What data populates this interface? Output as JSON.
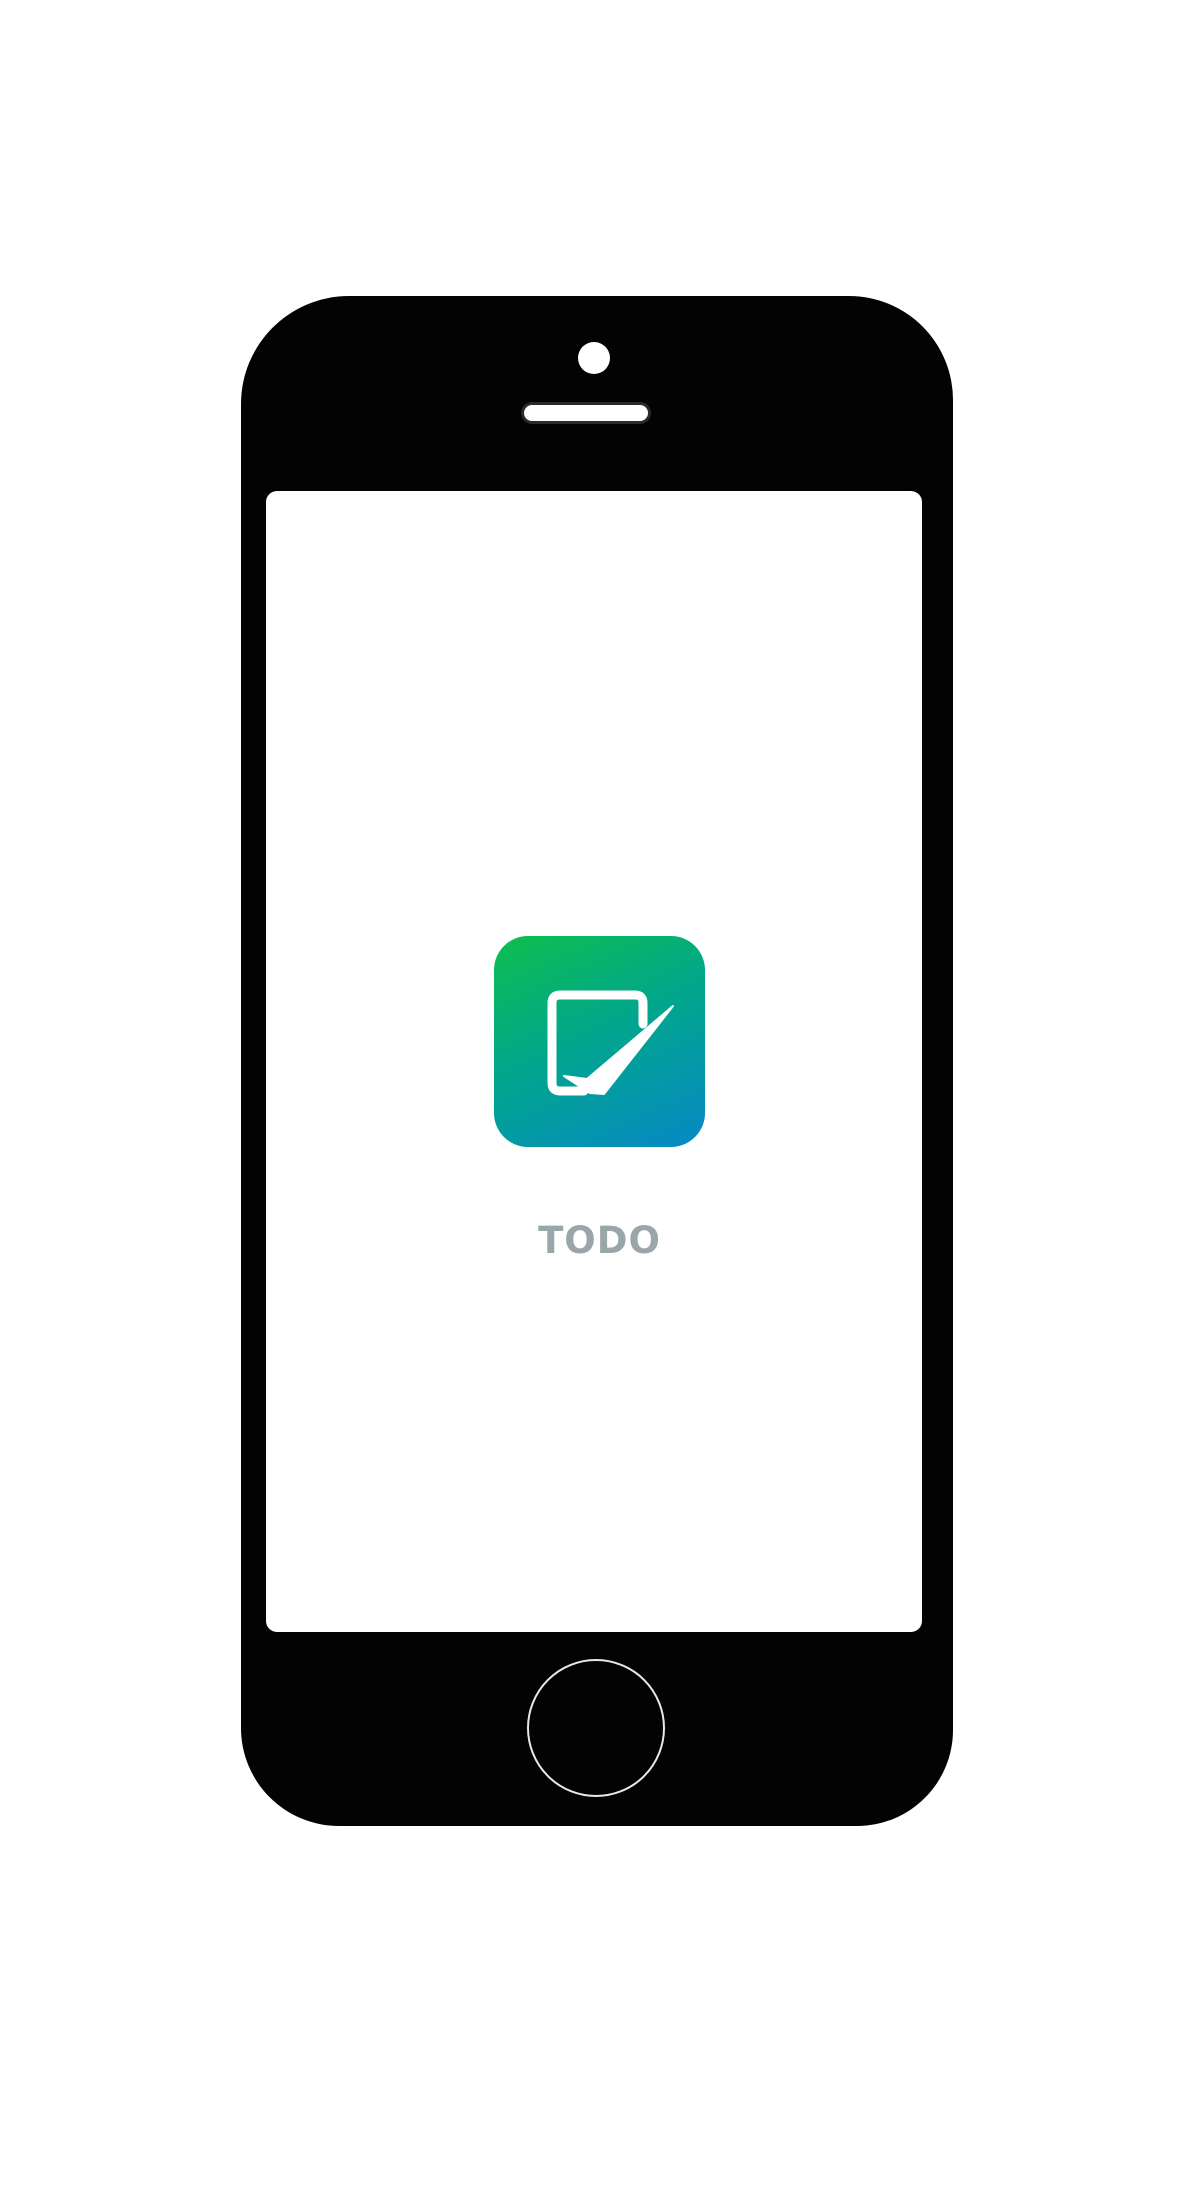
{
  "app": {
    "name": "TODO",
    "icon": "todo-checkbox-icon"
  },
  "colors": {
    "phone_body": "#030303",
    "screen_background": "#ffffff",
    "icon_gradient_start": "#0ebe4e",
    "icon_gradient_end": "#0688c7",
    "app_name_text": "#9aa7a9"
  }
}
